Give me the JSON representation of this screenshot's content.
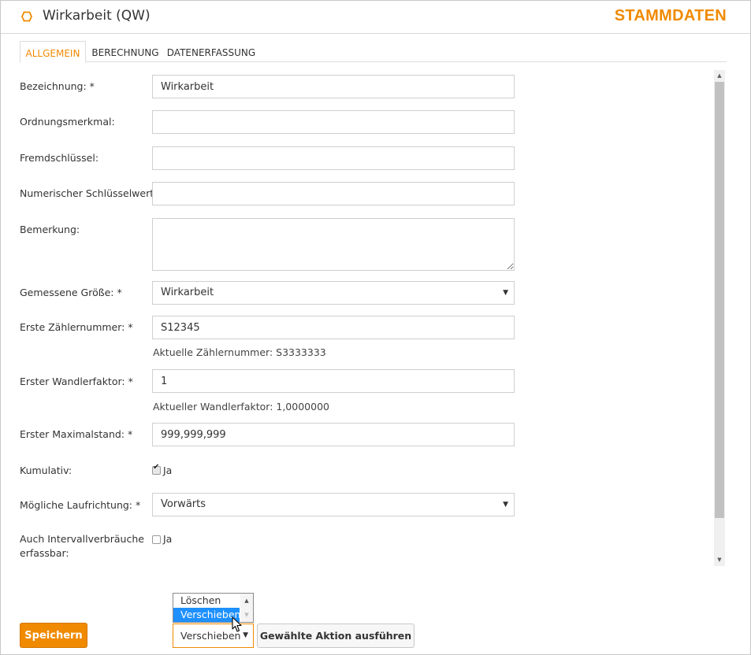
{
  "header": {
    "title": "Wirkarbeit (QW)",
    "section": "STAMMDATEN",
    "accent_color": "#f08a00",
    "icon": "hexagon-icon"
  },
  "tabs": [
    {
      "label": "ALLGEMEIN",
      "active": true
    },
    {
      "label": "BERECHNUNG",
      "active": false
    },
    {
      "label": "DATENERFASSUNG",
      "active": false
    }
  ],
  "form": {
    "bezeichnung": {
      "label": "Bezeichnung: *",
      "value": "Wirkarbeit"
    },
    "ordnungsmerkmal": {
      "label": "Ordnungsmerkmal:",
      "value": ""
    },
    "fremdschluessel": {
      "label": "Fremdschlüssel:",
      "value": ""
    },
    "numerischer_schluessel": {
      "label": "Numerischer Schlüsselwert:",
      "value": ""
    },
    "bemerkung": {
      "label": "Bemerkung:",
      "value": ""
    },
    "gemessene_groesse": {
      "label": "Gemessene Größe: *",
      "value": "Wirkarbeit"
    },
    "erste_zaehlernummer": {
      "label": "Erste Zählernummer: *",
      "value": "S12345",
      "hint": "Aktuelle Zählernummer: S3333333"
    },
    "erster_wandlerfaktor": {
      "label": "Erster Wandlerfaktor: *",
      "value": "1",
      "hint": "Aktueller Wandlerfaktor: 1,0000000"
    },
    "erster_maximalstand": {
      "label": "Erster Maximalstand: *",
      "value": "999,999,999"
    },
    "kumulativ": {
      "label": "Kumulativ:",
      "checked": true,
      "option": "Ja"
    },
    "laufrichtung": {
      "label": "Mögliche Laufrichtung: *",
      "value": "Vorwärts"
    },
    "intervall": {
      "label_line1": "Auch Intervallverbräuche",
      "label_line2": "erfassbar:",
      "checked": false,
      "option": "Ja"
    }
  },
  "footer": {
    "save_label": "Speichern",
    "action_options": [
      "Löschen",
      "Verschieben"
    ],
    "action_highlighted": "Verschieben",
    "action_selected": "Verschieben",
    "run_label": "Gewählte Aktion ausführen"
  }
}
